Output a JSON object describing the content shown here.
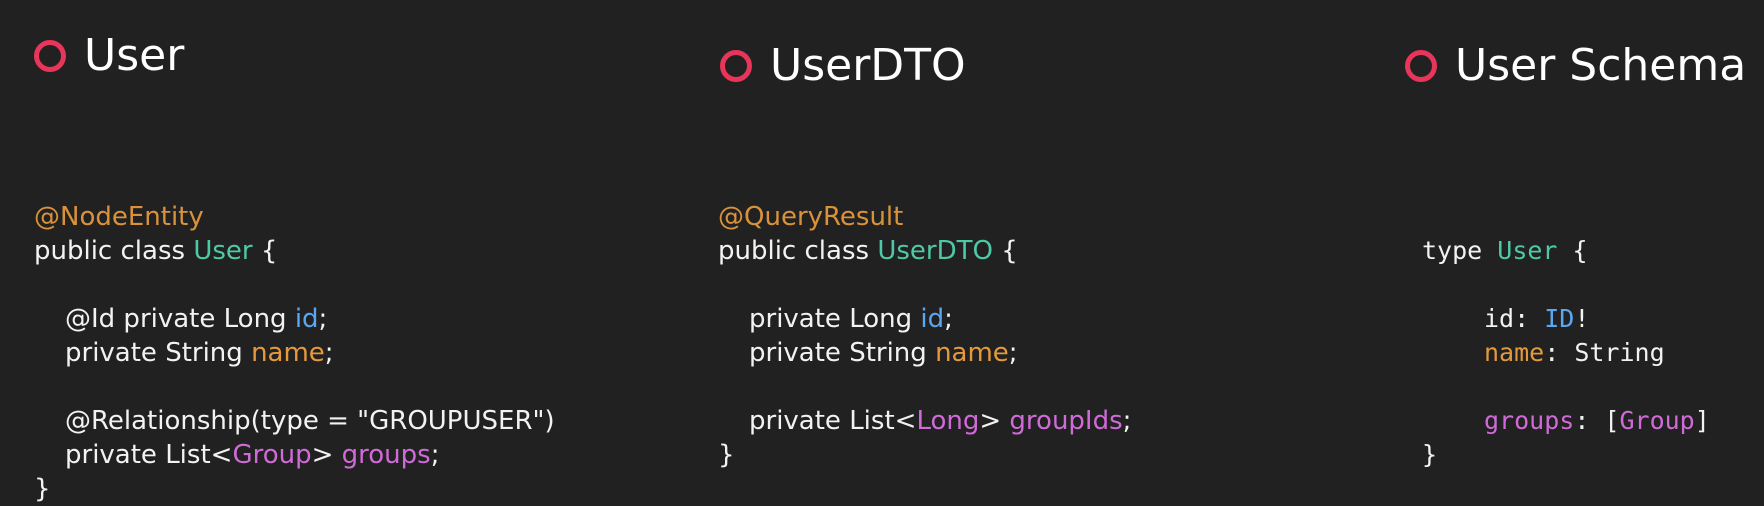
{
  "panels": [
    {
      "title": "User",
      "lines": [
        {
          "segs": [
            {
              "t": "@NodeEntity",
              "c": "ann"
            }
          ]
        },
        {
          "segs": [
            {
              "t": "public class ",
              "c": ""
            },
            {
              "t": "User",
              "c": "cls"
            },
            {
              "t": " {",
              "c": ""
            }
          ]
        },
        {
          "segs": []
        },
        {
          "indent": 1,
          "segs": [
            {
              "t": "@Id private Long ",
              "c": ""
            },
            {
              "t": "id",
              "c": "fld"
            },
            {
              "t": ";",
              "c": ""
            }
          ]
        },
        {
          "indent": 1,
          "segs": [
            {
              "t": "private String ",
              "c": ""
            },
            {
              "t": "name",
              "c": "nm"
            },
            {
              "t": ";",
              "c": ""
            }
          ]
        },
        {
          "segs": []
        },
        {
          "indent": 1,
          "segs": [
            {
              "t": "@Relationship(type = \"GROUPUSER\")",
              "c": ""
            }
          ]
        },
        {
          "indent": 1,
          "segs": [
            {
              "t": "private List<",
              "c": ""
            },
            {
              "t": "Group",
              "c": "gen"
            },
            {
              "t": "> ",
              "c": ""
            },
            {
              "t": "groups",
              "c": "gen"
            },
            {
              "t": ";",
              "c": ""
            }
          ]
        },
        {
          "segs": [
            {
              "t": "}",
              "c": ""
            }
          ]
        }
      ]
    },
    {
      "title": "UserDTO",
      "lines": [
        {
          "segs": [
            {
              "t": "@QueryResult",
              "c": "ann"
            }
          ]
        },
        {
          "segs": [
            {
              "t": "public class ",
              "c": ""
            },
            {
              "t": "UserDTO",
              "c": "cls"
            },
            {
              "t": " {",
              "c": ""
            }
          ]
        },
        {
          "segs": []
        },
        {
          "indent": 1,
          "segs": [
            {
              "t": "private Long ",
              "c": ""
            },
            {
              "t": "id",
              "c": "fld"
            },
            {
              "t": ";",
              "c": ""
            }
          ]
        },
        {
          "indent": 1,
          "segs": [
            {
              "t": "private String ",
              "c": ""
            },
            {
              "t": "name",
              "c": "nm"
            },
            {
              "t": ";",
              "c": ""
            }
          ]
        },
        {
          "segs": []
        },
        {
          "indent": 1,
          "segs": [
            {
              "t": "private List<",
              "c": ""
            },
            {
              "t": "Long",
              "c": "gen"
            },
            {
              "t": "> ",
              "c": ""
            },
            {
              "t": "groupIds",
              "c": "gen"
            },
            {
              "t": ";",
              "c": ""
            }
          ]
        },
        {
          "segs": [
            {
              "t": "}",
              "c": ""
            }
          ]
        }
      ]
    },
    {
      "title": "User Schema",
      "lines": [
        {
          "segs": [
            {
              "t": "type ",
              "c": ""
            },
            {
              "t": "User",
              "c": "cls"
            },
            {
              "t": " {",
              "c": ""
            }
          ]
        },
        {
          "segs": []
        },
        {
          "indent": 2,
          "segs": [
            {
              "t": "id",
              "c": ""
            },
            {
              "t": ": ",
              "c": ""
            },
            {
              "t": "ID",
              "c": "fld"
            },
            {
              "t": "!",
              "c": ""
            }
          ]
        },
        {
          "indent": 2,
          "segs": [
            {
              "t": "name",
              "c": "nm"
            },
            {
              "t": ": String",
              "c": ""
            }
          ]
        },
        {
          "segs": []
        },
        {
          "indent": 2,
          "segs": [
            {
              "t": "groups",
              "c": "gen"
            },
            {
              "t": ": [",
              "c": ""
            },
            {
              "t": "Group",
              "c": "gen"
            },
            {
              "t": "]",
              "c": ""
            }
          ]
        },
        {
          "segs": [
            {
              "t": "}",
              "c": ""
            }
          ]
        }
      ]
    }
  ],
  "colors": {
    "background": "#212121",
    "bullet": "#e8355a",
    "annotation": "#d9923a",
    "class_name": "#4ec9a6",
    "id_field": "#5aa6f0",
    "name_field": "#e49a3c",
    "generic": "#d06ad8"
  },
  "icons": {
    "bullet": "circle-outline-icon"
  }
}
